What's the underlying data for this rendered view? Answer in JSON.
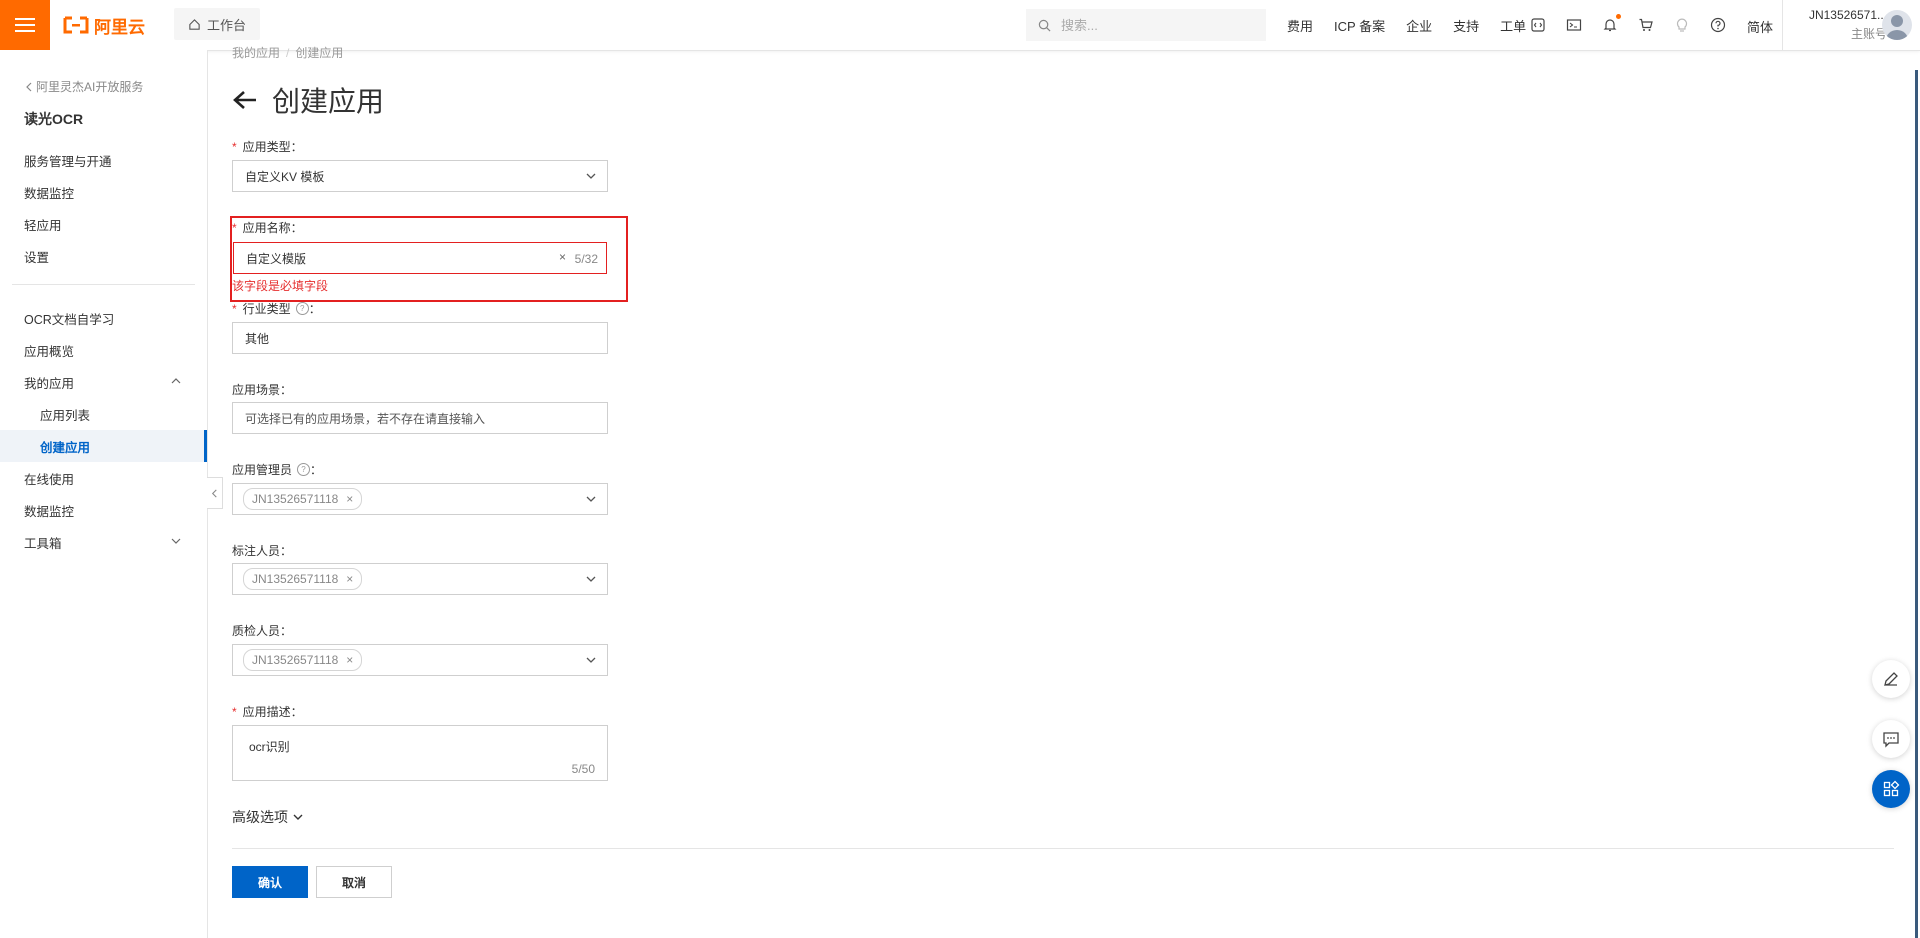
{
  "topbar": {
    "brand": "阿里云",
    "workbench": "工作台",
    "search_placeholder": "搜索...",
    "links": [
      "费用",
      "ICP 备案",
      "企业",
      "支持",
      "工单"
    ],
    "icons": [
      "code-icon",
      "terminal-icon",
      "bell-icon",
      "cart-icon",
      "lightbulb-icon",
      "help-icon"
    ],
    "language": "简体",
    "account_name": "JN13526571...",
    "account_role": "主账号",
    "accent": "#ff6a00"
  },
  "sidebar": {
    "back_label": "阿里灵杰AI开放服务",
    "product": "读光OCR",
    "group1": [
      "服务管理与开通",
      "数据监控",
      "轻应用",
      "设置"
    ],
    "group2": {
      "learn": "OCR文档自学习",
      "overview": "应用概览",
      "my_apps": "我的应用",
      "app_list": "应用列表",
      "create_app": "创建应用",
      "online": "在线使用",
      "monitor": "数据监控",
      "toolbox": "工具箱"
    },
    "active_color": "#0064c8"
  },
  "breadcrumb": [
    "我的应用",
    "创建应用"
  ],
  "page_title": "创建应用",
  "form": {
    "app_type": {
      "label": "应用类型：",
      "value": "自定义KV 模板"
    },
    "app_name": {
      "label": "应用名称：",
      "value": "自定义模版",
      "count": "5/32",
      "error": "该字段是必填字段"
    },
    "industry": {
      "label": "行业类型",
      "colon": "：",
      "value": "其他"
    },
    "scene": {
      "label": "应用场景：",
      "placeholder": "可选择已有的应用场景，若不存在请直接输入"
    },
    "admin": {
      "label": "应用管理员",
      "colon": "：",
      "tag": "JN13526571118"
    },
    "annotator": {
      "label": "标注人员：",
      "tag": "JN13526571118"
    },
    "qa": {
      "label": "质检人员：",
      "tag": "JN13526571118"
    },
    "description": {
      "label": "应用描述：",
      "value": "ocr识别",
      "count": "5/50"
    },
    "advanced": "高级选项",
    "confirm": "确认",
    "cancel": "取消"
  }
}
